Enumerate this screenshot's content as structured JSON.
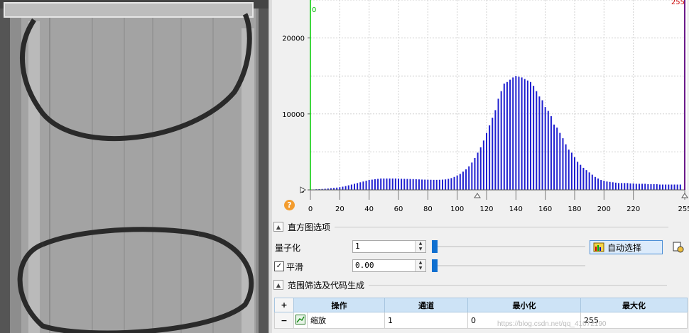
{
  "chart_data": {
    "type": "bar",
    "x_ticks": [
      "0",
      "20",
      "40",
      "60",
      "80",
      "100",
      "120",
      "140",
      "160",
      "180",
      "200",
      "220",
      "255"
    ],
    "y_ticks": [
      "0",
      "10000",
      "20000"
    ],
    "ylim": [
      0,
      25000
    ],
    "xlim": [
      0,
      255
    ],
    "grid": true,
    "markers": {
      "low": "0",
      "high": "255"
    },
    "series": [
      {
        "x": [
          2,
          4,
          6,
          8,
          10,
          12,
          14,
          16,
          18,
          20,
          22,
          24,
          26,
          28,
          30,
          32,
          34,
          36,
          38,
          40,
          42,
          44,
          46,
          48,
          50,
          52,
          54,
          56,
          58,
          60,
          62,
          64,
          66,
          68,
          70,
          72,
          74,
          76,
          78,
          80,
          82,
          84,
          86,
          88,
          90,
          92,
          94,
          96,
          98,
          100,
          102,
          104,
          106,
          108,
          110,
          112,
          114,
          116,
          118,
          120,
          122,
          124,
          126,
          128,
          130,
          132,
          134,
          136,
          138,
          140,
          142,
          144,
          146,
          148,
          150,
          152,
          154,
          156,
          158,
          160,
          162,
          164,
          166,
          168,
          170,
          172,
          174,
          176,
          178,
          180,
          182,
          184,
          186,
          188,
          190,
          192,
          194,
          196,
          198,
          200,
          202,
          204,
          206,
          208,
          210,
          212,
          214,
          216,
          218,
          220,
          222,
          224,
          226,
          228,
          230,
          232,
          234,
          236,
          238,
          240,
          242,
          244,
          246,
          248,
          250,
          252
        ],
        "values": [
          50,
          80,
          100,
          120,
          150,
          180,
          220,
          260,
          300,
          350,
          420,
          500,
          600,
          700,
          800,
          900,
          1000,
          1100,
          1200,
          1300,
          1350,
          1400,
          1450,
          1500,
          1500,
          1500,
          1500,
          1500,
          1500,
          1480,
          1460,
          1450,
          1440,
          1430,
          1420,
          1400,
          1380,
          1360,
          1350,
          1340,
          1330,
          1320,
          1320,
          1330,
          1350,
          1380,
          1450,
          1550,
          1700,
          1900,
          2100,
          2400,
          2700,
          3100,
          3600,
          4200,
          4900,
          5600,
          6500,
          7500,
          8500,
          9500,
          10500,
          12000,
          13000,
          14000,
          14200,
          14500,
          14800,
          15000,
          14900,
          14800,
          14600,
          14400,
          14200,
          13700,
          13000,
          12300,
          11800,
          10900,
          10400,
          9700,
          8600,
          8200,
          7500,
          6800,
          6000,
          5300,
          4900,
          4300,
          3700,
          3300,
          2900,
          2600,
          2300,
          2000,
          1700,
          1500,
          1300,
          1200,
          1100,
          1050,
          1000,
          950,
          900,
          900,
          900,
          900,
          850,
          850,
          800,
          800,
          800,
          800,
          750,
          750,
          750,
          750,
          700,
          700,
          700,
          700,
          700,
          700,
          700,
          700
        ]
      }
    ]
  },
  "histogram_options": {
    "title": "直方图选项",
    "quantize_label": "量子化",
    "quantize_value": "1",
    "auto_select_label": "自动选择",
    "smooth_label": "平滑",
    "smooth_checked": true,
    "smooth_value": "0.00"
  },
  "range_section": {
    "title": "范围筛选及代码生成",
    "columns": [
      "操作",
      "通道",
      "最小化",
      "最大化"
    ],
    "rows": [
      {
        "op": "缩放",
        "channel": "1",
        "min": "0",
        "max": "255"
      }
    ]
  },
  "watermark": "https://blog.csdn.net/qq_41072190",
  "colors": {
    "bars": "#1f1fd0",
    "low_marker": "#00cc00",
    "high_marker": "#6a1a8a",
    "accent": "#0f6fd0"
  }
}
